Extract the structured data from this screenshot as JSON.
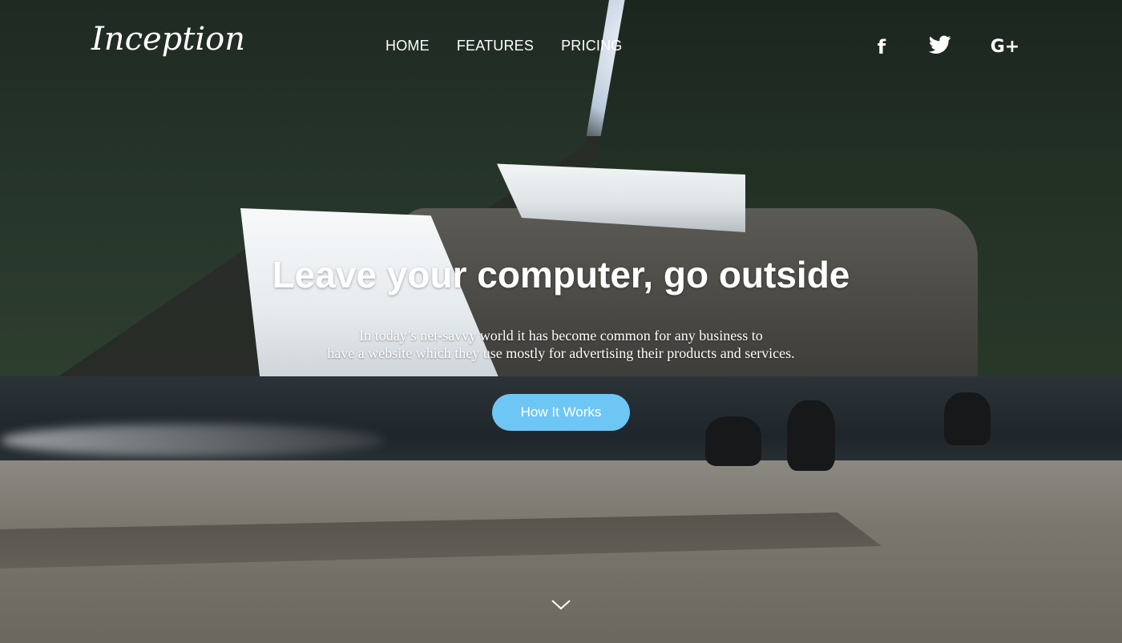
{
  "brand": {
    "logo": "Inception"
  },
  "nav": {
    "items": [
      {
        "label": "HOME"
      },
      {
        "label": "FEATURES"
      },
      {
        "label": "PRICING"
      }
    ]
  },
  "social": {
    "facebook_glyph": "f",
    "twitter_glyph": "🐦",
    "googleplus_glyph": "G+"
  },
  "hero": {
    "headline": "Leave your computer, go outside",
    "sub_line1": "In today’s net-savvy world it has become common for any business to",
    "sub_line2": "have a website which they use mostly for advertising their products and services.",
    "cta_label": "How It Works"
  },
  "colors": {
    "cta": "#6ec6f5",
    "text": "#ffffff"
  }
}
